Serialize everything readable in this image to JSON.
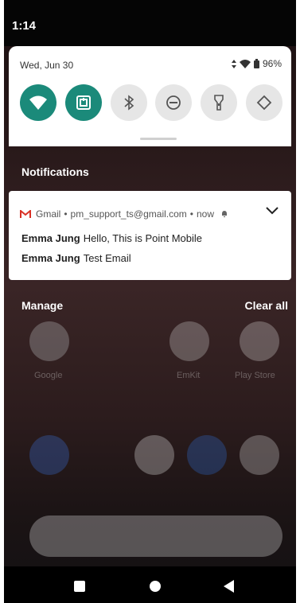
{
  "status": {
    "time": "1:14"
  },
  "quick_settings": {
    "date": "Wed, Jun 30",
    "battery": "96%",
    "tiles": [
      "wifi-icon",
      "nfc-icon",
      "bluetooth-icon",
      "do-not-disturb-icon",
      "flashlight-icon",
      "auto-rotate-icon"
    ]
  },
  "notifications": {
    "header": "Notifications",
    "card": {
      "app": "Gmail",
      "account": "pm_support_ts@gmail.com",
      "time": "now",
      "messages": [
        {
          "sender": "Emma Jung",
          "text": "Hello, This is Point Mobile"
        },
        {
          "sender": "Emma Jung",
          "text": "Test Email"
        }
      ]
    },
    "manage": "Manage",
    "clear_all": "Clear all"
  },
  "home": {
    "apps": [
      "Google",
      "EmKit",
      "Play Store"
    ]
  },
  "colors": {
    "accent": "#1b8a7a",
    "gmail_red": "#d93025"
  }
}
